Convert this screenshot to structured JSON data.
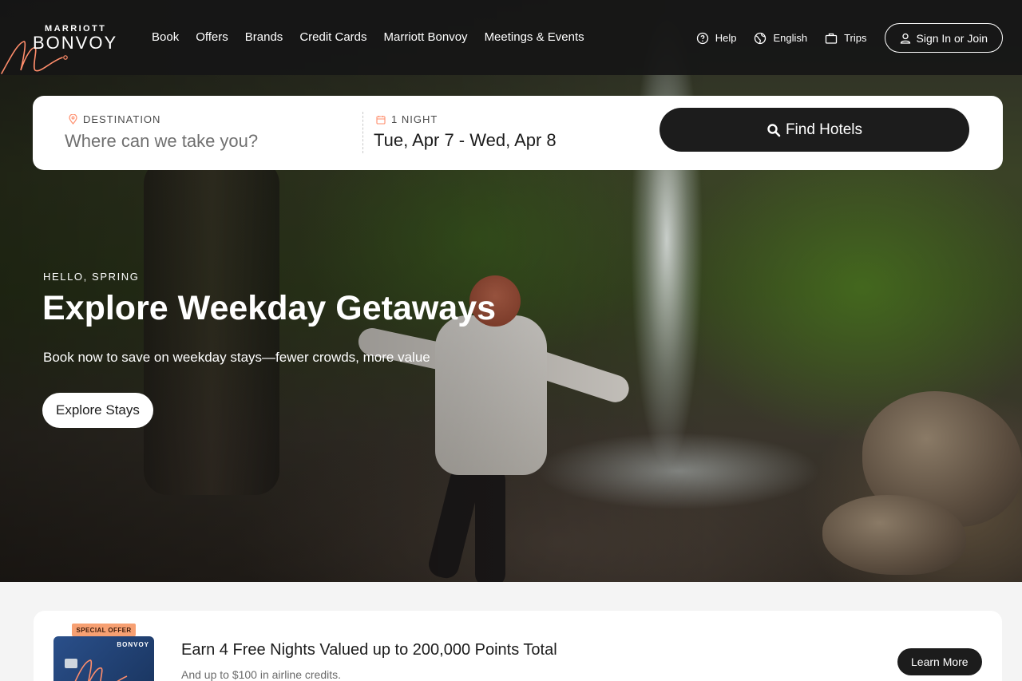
{
  "header": {
    "logo_top": "MARRIOTT",
    "logo_main": "BONVOY",
    "nav": [
      "Book",
      "Offers",
      "Brands",
      "Credit Cards",
      "Marriott Bonvoy",
      "Meetings & Events"
    ],
    "utility": {
      "help": "Help",
      "language": "English",
      "trips": "Trips"
    },
    "sign_in": "Sign In or Join"
  },
  "search": {
    "destination_label": "DESTINATION",
    "destination_placeholder": "Where can we take you?",
    "dates_label": "1 NIGHT",
    "dates_value": "Tue, Apr 7 - Wed, Apr 8",
    "find_button": "Find Hotels"
  },
  "hero": {
    "eyebrow": "HELLO, SPRING",
    "title": "Explore Weekday Getaways",
    "subtitle": "Book now to save on weekday stays—fewer crowds, more value",
    "cta": "Explore Stays"
  },
  "offer": {
    "badge": "SPECIAL OFFER",
    "card_brand": "BONVOY",
    "title": "Earn 4 Free Nights Valued up to 200,000 Points Total",
    "subtitle": "And up to $100 in airline credits.",
    "cta": "Learn More"
  },
  "colors": {
    "accent": "#ff8d6b",
    "dark": "#1c1c1c"
  }
}
